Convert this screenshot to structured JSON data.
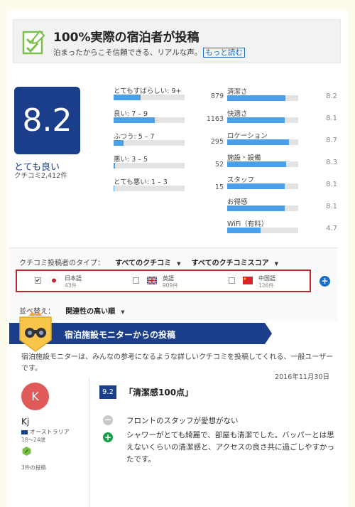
{
  "banner": {
    "title": "100%実際の宿泊者が投稿",
    "subtitle": "泊まったからこそ信頼できる、リアルな声。",
    "link": "もっと読む"
  },
  "score": {
    "value": "8.2",
    "word": "とても良い",
    "count": "クチコミ2,412件"
  },
  "distribution": [
    {
      "label": "とてもすばらしい: 9+",
      "count": "879",
      "fraction": 0.38
    },
    {
      "label": "良い: 7 – 9",
      "count": "1163",
      "fraction": 0.58
    },
    {
      "label": "ふつう: 5 – 7",
      "count": "295",
      "fraction": 0.14
    },
    {
      "label": "悪い: 3 – 5",
      "count": "52",
      "fraction": 0.02
    },
    {
      "label": "とても悪い: 1 – 3",
      "count": "15",
      "fraction": 0.01
    }
  ],
  "categories": [
    {
      "label": "清潔さ",
      "score": "8.2",
      "fraction": 0.82
    },
    {
      "label": "快適さ",
      "score": "8.1",
      "fraction": 0.81
    },
    {
      "label": "ロケーション",
      "score": "8.7",
      "fraction": 0.87
    },
    {
      "label": "施設・設備",
      "score": "8.3",
      "fraction": 0.83
    },
    {
      "label": "スタッフ",
      "score": "8.1",
      "fraction": 0.81
    },
    {
      "label": "お得感",
      "score": "8.1",
      "fraction": 0.81
    },
    {
      "label": "WiFi（有料）",
      "score": "4.7",
      "fraction": 0.47
    }
  ],
  "filters": {
    "type_label": "クチコミ投稿者のタイプ：",
    "type_value": "すべてのクチコミ",
    "score_value": "すべてのクチコミスコア",
    "sort_label": "並べ替え：",
    "sort_value": "関連性の高い順",
    "languages": [
      {
        "name": "日本語",
        "count": "43件",
        "checked": true
      },
      {
        "name": "英語",
        "count": "909件",
        "checked": false
      },
      {
        "name": "中国語",
        "count": "126件",
        "checked": false
      }
    ]
  },
  "monitor": {
    "title": "宿泊施設モニターからの投稿",
    "description": "宿泊施設モニターは、みんなの参考になるような詳しいクチコミを投稿してくれる、一般ユーザーです。"
  },
  "review": {
    "date": "2016年11月30日",
    "score": "9.2",
    "title": "「清潔感100点」",
    "negative": "フロントのスタッフが愛想がない",
    "positive": "シャワーがとても綺麗で、部屋も清潔でした。バッパーとは思えないくらいの清潔感と、アクセスの良さ共に過ごしやすかったです。"
  },
  "reviewer": {
    "initial": "K",
    "name": "Kj",
    "country": "オーストラリア",
    "age": "18～24歳",
    "posts": "3件の投稿"
  },
  "colors": {
    "brand_blue": "#1b3e8a",
    "bar_blue": "#4aa0e8",
    "highlight_red": "#c0282d",
    "positive_green": "#1a9e4a",
    "avatar_red": "#e05a5a"
  }
}
